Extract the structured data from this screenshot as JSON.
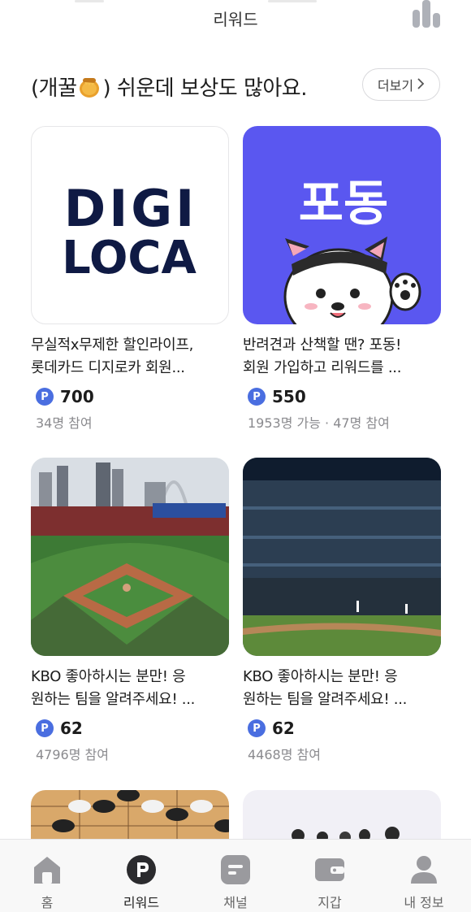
{
  "header": {
    "title": "리워드",
    "stats_icon": "bar-chart-icon"
  },
  "section": {
    "title_prefix": "(개꿀",
    "title_suffix": ") 쉬운데 보상도 많아요.",
    "emoji_icon": "honey-pot-icon",
    "more_label": "더보기",
    "more_icon": "chevron-right-icon"
  },
  "cards": [
    {
      "image": "DIGILOCA logo",
      "logo_line1": "DIGI",
      "logo_line2": "LOCA",
      "desc_line1": "무실적x무제한 할인라이프,",
      "desc_line2": "롯데카드 디지로카 회원...",
      "points": "700",
      "meta": "34명 참여"
    },
    {
      "image": "Podong puppy banner",
      "logo_text": "포동",
      "desc_line1": "반려견과 산책할 땐? 포동!",
      "desc_line2": "회원 가입하고 리워드를 ...",
      "points": "550",
      "meta": "1953명 가능 · 47명 참여"
    },
    {
      "image": "baseball stadium daytime",
      "desc_line1": "KBO 좋아하시는 분만! 응",
      "desc_line2": "원하는 팀을 알려주세요! ...",
      "points": "62",
      "meta": "4796명 참여"
    },
    {
      "image": "baseball stadium night",
      "desc_line1": "KBO 좋아하시는 분만! 응",
      "desc_line2": "원하는 팀을 알려주세요! ...",
      "points": "62",
      "meta": "4468명 참여"
    },
    {
      "image": "go board stones"
    },
    {
      "image": "group photo"
    }
  ],
  "point_badge": "P",
  "tabs": [
    {
      "label": "홈",
      "icon": "home-icon",
      "active": false
    },
    {
      "label": "리워드",
      "icon": "reward-p-icon",
      "active": true
    },
    {
      "label": "채널",
      "icon": "channel-icon",
      "active": false
    },
    {
      "label": "지갑",
      "icon": "wallet-icon",
      "active": false
    },
    {
      "label": "내 정보",
      "icon": "profile-icon",
      "active": false
    }
  ],
  "colors": {
    "accent": "#4a6ee0",
    "podong_bg": "#5a57f0",
    "digiloca_text": "#0f1a44",
    "tab_icon": "#9a9a9e",
    "tab_active": "#2b2b2e"
  }
}
